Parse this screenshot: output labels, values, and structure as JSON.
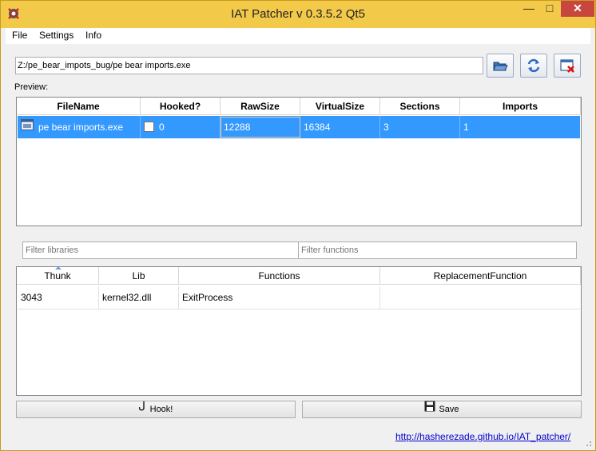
{
  "window": {
    "title": "IAT Patcher v 0.3.5.2 Qt5",
    "min_label": "—",
    "max_label": "□",
    "close_label": "✕"
  },
  "menu": {
    "items": [
      "File",
      "Settings",
      "Info"
    ]
  },
  "path": {
    "value": "Z:/pe_bear_impots_bug/pe bear imports.exe"
  },
  "toolbar": {
    "icons": [
      "open-folder-icon",
      "reload-icon",
      "unload-icon"
    ]
  },
  "preview": {
    "label": "Preview:",
    "columns": [
      "FileName",
      "Hooked?",
      "RawSize",
      "VirtualSize",
      "Sections",
      "Imports"
    ],
    "rows": [
      {
        "filename": "pe bear imports.exe",
        "hooked": "0",
        "rawsize": "12288",
        "virtualsize": "16384",
        "sections": "3",
        "imports": "1",
        "selected": true
      }
    ]
  },
  "filters": {
    "libraries_placeholder": "Filter libraries",
    "functions_placeholder": "Filter functions"
  },
  "functions_table": {
    "columns": [
      "Thunk",
      "Lib",
      "Functions",
      "ReplacementFunction"
    ],
    "rows": [
      {
        "thunk": "3043",
        "lib": "kernel32.dll",
        "function": "ExitProcess",
        "replacement": ""
      }
    ]
  },
  "buttons": {
    "hook_label": "Hook!",
    "save_label": "Save"
  },
  "footer": {
    "link_text": "http://hasherezade.github.io/IAT_patcher/"
  },
  "colors": {
    "titlebar": "#f3c94a",
    "selection": "#3399ff",
    "close": "#c7463d",
    "link": "#0000d0"
  }
}
